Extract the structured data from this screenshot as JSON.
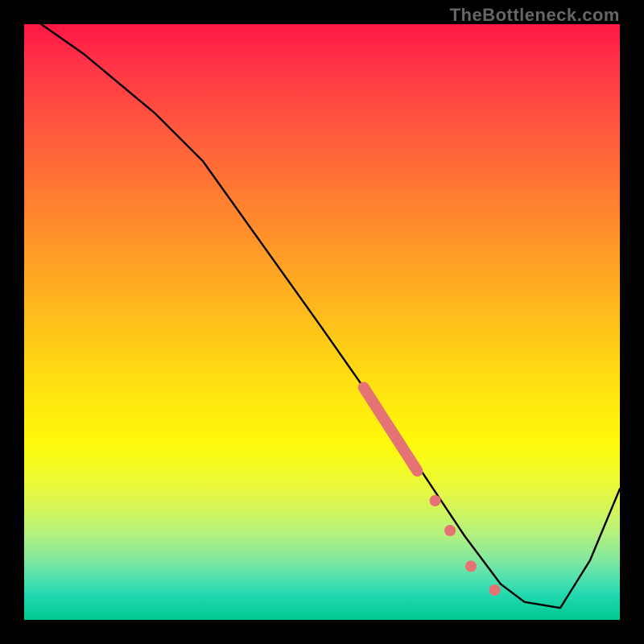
{
  "watermark": "TheBottleneck.com",
  "chart_data": {
    "type": "line",
    "title": "",
    "xlabel": "",
    "ylabel": "",
    "xlim": [
      0,
      100
    ],
    "ylim": [
      0,
      100
    ],
    "background": "rainbow-vertical-gradient",
    "background_meaning": "red=high bottleneck, green=low bottleneck",
    "series": [
      {
        "name": "bottleneck-curve",
        "color": "#000000",
        "x": [
          0,
          10,
          22,
          30,
          40,
          50,
          57,
          62,
          66,
          70,
          74,
          77,
          80,
          84,
          90,
          95,
          100
        ],
        "y": [
          102,
          95,
          85,
          77,
          63,
          49,
          39,
          32,
          26,
          20,
          14,
          10,
          6,
          3,
          2,
          10,
          22
        ]
      }
    ],
    "markers": [
      {
        "name": "highlight-segment",
        "type": "thick-line",
        "color": "#e57373",
        "x": [
          57,
          66
        ],
        "y": [
          39,
          25
        ]
      },
      {
        "name": "dot-1",
        "type": "circle",
        "color": "#e57373",
        "x": 69,
        "y": 20
      },
      {
        "name": "dot-2",
        "type": "circle",
        "color": "#e57373",
        "x": 71.5,
        "y": 15
      },
      {
        "name": "dot-3",
        "type": "circle",
        "color": "#e57373",
        "x": 75,
        "y": 9
      },
      {
        "name": "dot-4",
        "type": "circle",
        "color": "#e57373",
        "x": 79,
        "y": 5
      }
    ]
  }
}
